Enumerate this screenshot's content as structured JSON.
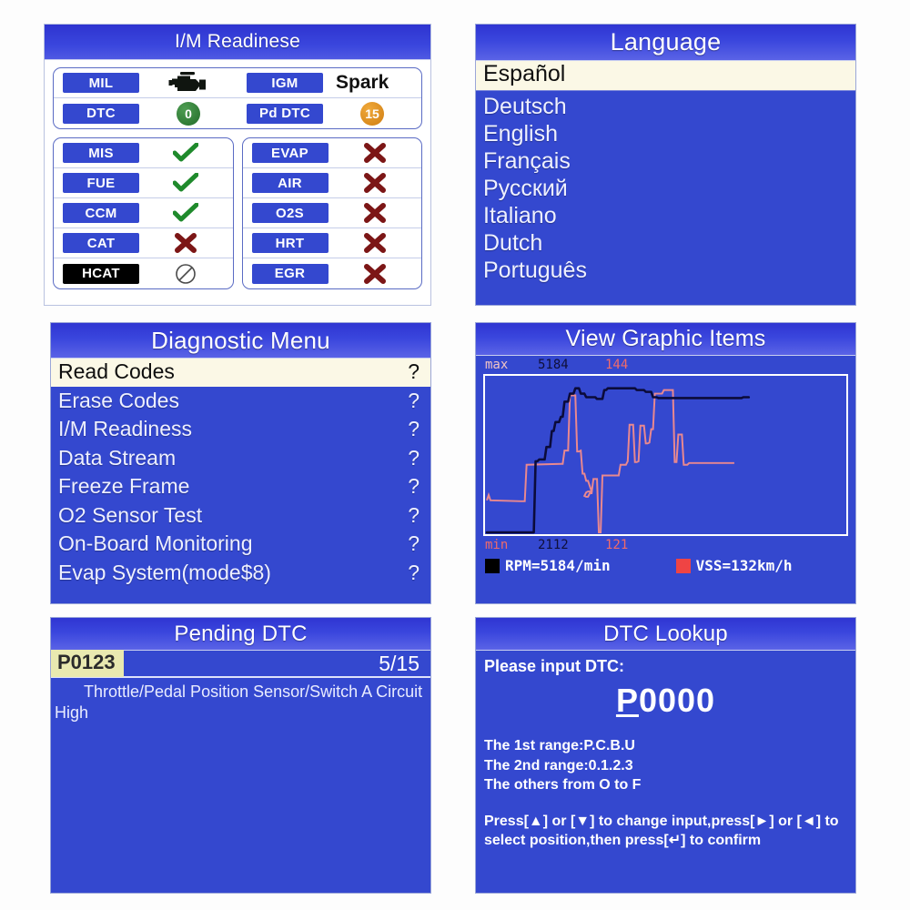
{
  "panels": {
    "im_readiness": {
      "title": "I/M Readinese",
      "top_rows": [
        {
          "left_label": "MIL",
          "left_value_type": "engine-icon",
          "right_label": "IGM",
          "right_value": "Spark"
        },
        {
          "left_label": "DTC",
          "left_value": "0",
          "right_label": "Pd DTC",
          "right_value": "15"
        }
      ],
      "monitors_left": [
        {
          "label": "MIS",
          "status": "ok"
        },
        {
          "label": "FUE",
          "status": "ok"
        },
        {
          "label": "CCM",
          "status": "ok"
        },
        {
          "label": "CAT",
          "status": "fail"
        },
        {
          "label": "HCAT",
          "status": "na"
        }
      ],
      "monitors_right": [
        {
          "label": "EVAP",
          "status": "fail"
        },
        {
          "label": "AIR",
          "status": "fail"
        },
        {
          "label": "O2S",
          "status": "fail"
        },
        {
          "label": "HRT",
          "status": "fail"
        },
        {
          "label": "EGR",
          "status": "fail"
        }
      ]
    },
    "language": {
      "title": "Language",
      "selected": "Español",
      "items": [
        "Deutsch",
        "English",
        "Français",
        "Русский",
        "Italiano",
        "Dutch",
        "Português"
      ]
    },
    "diagnostic_menu": {
      "title": "Diagnostic Menu",
      "selected": {
        "label": "Read Codes",
        "marker": "?"
      },
      "items": [
        {
          "label": "Erase Codes",
          "marker": "?"
        },
        {
          "label": "I/M Readiness",
          "marker": "?"
        },
        {
          "label": "Data Stream",
          "marker": "?"
        },
        {
          "label": "Freeze Frame",
          "marker": "?"
        },
        {
          "label": "O2 Sensor Test",
          "marker": "?"
        },
        {
          "label": "On-Board Monitoring",
          "marker": "?"
        },
        {
          "label": "Evap System(mode$8)",
          "marker": "?"
        }
      ]
    },
    "view_graphic_items": {
      "title": "View Graphic Items",
      "max_label": "max",
      "max_rpm": "5184",
      "max_vss": "144",
      "min_label": "min",
      "min_rpm": "2112",
      "min_vss": "121",
      "legend": [
        {
          "swatch": "black",
          "text": "RPM=5184/min"
        },
        {
          "swatch": "red",
          "text": "VSS=132km/h"
        }
      ]
    },
    "pending_dtc": {
      "title": "Pending DTC",
      "code": "P0123",
      "count": "5/15",
      "description": "Throttle/Pedal Position Sensor/Switch A Circuit High"
    },
    "dtc_lookup": {
      "title": "DTC Lookup",
      "prompt": "Please input DTC:",
      "code_first": "P",
      "code_rest": "0000",
      "line1": "The 1st range:P.C.B.U",
      "line2": "The 2nd range:0.1.2.3",
      "line3": " The others from O to F",
      "hint": "Press[▲] or [▼] to change input,press[►] or [◄] to select position,then press[↵] to confirm"
    }
  },
  "chart_data": {
    "type": "line",
    "title": "View Graphic Items",
    "series": [
      {
        "name": "RPM",
        "color": "#0b0b3a",
        "unit": "/min",
        "max": 5184,
        "min": 2112,
        "current": 5184
      },
      {
        "name": "VSS",
        "color": "#e9888f",
        "unit": "km/h",
        "max": 144,
        "min": 121,
        "current": 132
      }
    ],
    "ylim_labels": {
      "top_left": "max",
      "bottom_left": "min"
    },
    "grid": false,
    "legend_position": "bottom"
  },
  "colors": {
    "panel_blue": "#3448cf",
    "title_blue": "#3a46dd",
    "highlight_cream": "#fbf8e6",
    "code_highlight": "#e9e9b0",
    "check_green": "#1f8a2c",
    "cross_red": "#7c1616",
    "badge_green": "#2f7a34",
    "badge_orange": "#e09322"
  }
}
